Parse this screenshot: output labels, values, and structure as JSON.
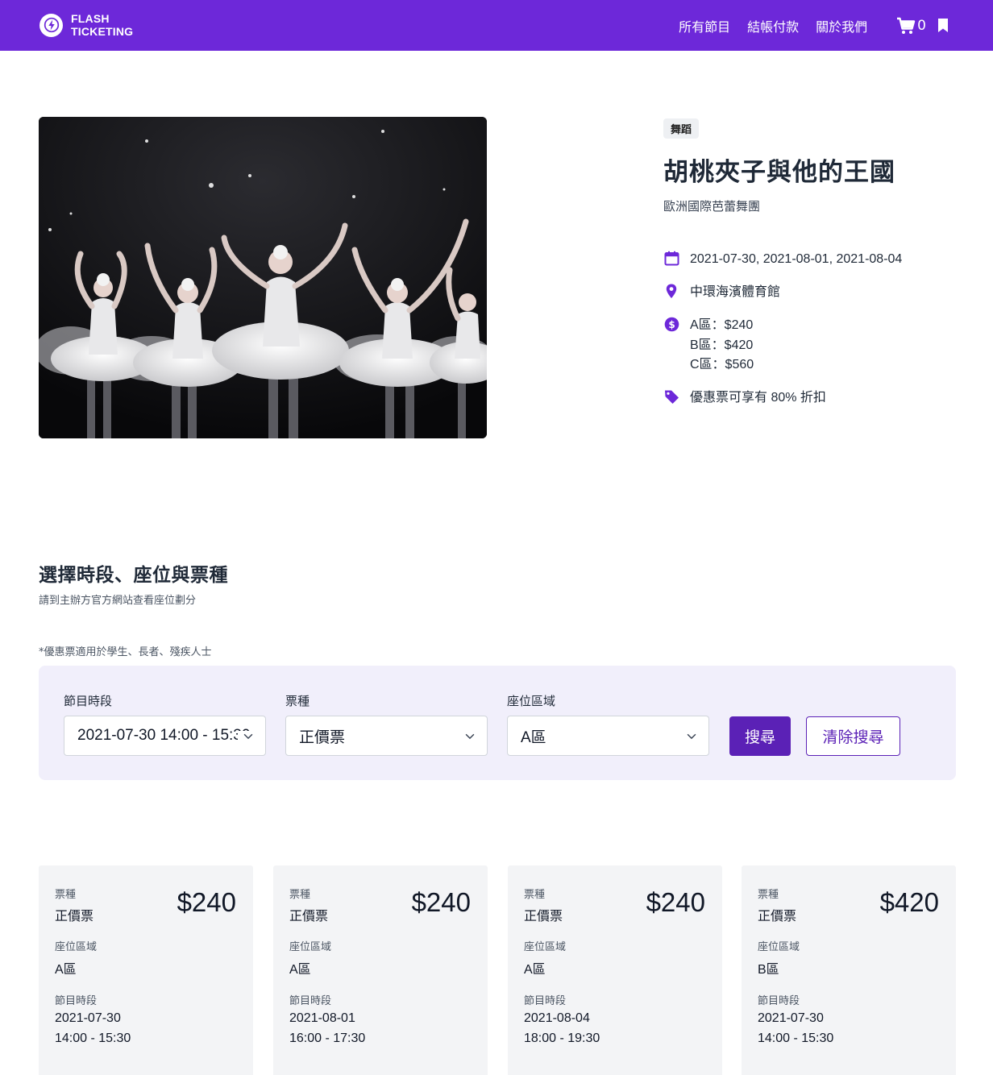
{
  "brand": {
    "line1": "FLASH",
    "line2": "TICKETING"
  },
  "nav": {
    "links": [
      "所有節目",
      "結帳付款",
      "關於我們"
    ],
    "cart_count": "0"
  },
  "event": {
    "category": "舞蹈",
    "title": "胡桃夾子與他的王國",
    "organizer": "歐洲國際芭蕾舞團",
    "dates": "2021-07-30, 2021-08-01, 2021-08-04",
    "venue": "中環海濱體育館",
    "prices": [
      "A區：$240",
      "B區：$420",
      "C區：$560"
    ],
    "discount": "優惠票可享有 80% 折扣"
  },
  "section": {
    "title": "選擇時段、座位與票種",
    "subtitle": "請到主辦方官方網站查看座位劃分",
    "note": "*優惠票適用於學生、長者、殘疾人士"
  },
  "filters": {
    "session_label": "節目時段",
    "session_value": "2021-07-30 14:00 - 15:30",
    "ticket_label": "票種",
    "ticket_value": "正價票",
    "zone_label": "座位區域",
    "zone_value": "A區",
    "search_button": "搜尋",
    "clear_button": "清除搜尋"
  },
  "cards": [
    {
      "type_label": "票種",
      "type": "正價票",
      "price": "$240",
      "zone_label": "座位區域",
      "zone": "A區",
      "session_label": "節目時段",
      "date": "2021-07-30",
      "time": "14:00 - 15:30"
    },
    {
      "type_label": "票種",
      "type": "正價票",
      "price": "$240",
      "zone_label": "座位區域",
      "zone": "A區",
      "session_label": "節目時段",
      "date": "2021-08-01",
      "time": "16:00 - 17:30"
    },
    {
      "type_label": "票種",
      "type": "正價票",
      "price": "$240",
      "zone_label": "座位區域",
      "zone": "A區",
      "session_label": "節目時段",
      "date": "2021-08-04",
      "time": "18:00 - 19:30"
    },
    {
      "type_label": "票種",
      "type": "正價票",
      "price": "$420",
      "zone_label": "座位區域",
      "zone": "B區",
      "session_label": "節目時段",
      "date": "2021-07-30",
      "time": "14:00 - 15:30"
    }
  ],
  "colors": {
    "primary": "#6d28d9",
    "button": "#5b21b6",
    "panel": "#f1effb",
    "card": "#f3f4f6"
  },
  "icons": [
    "lightning-icon",
    "cart-icon",
    "bookmark-icon",
    "calendar-icon",
    "location-pin-icon",
    "dollar-icon",
    "tag-icon",
    "chevron-down-icon"
  ]
}
